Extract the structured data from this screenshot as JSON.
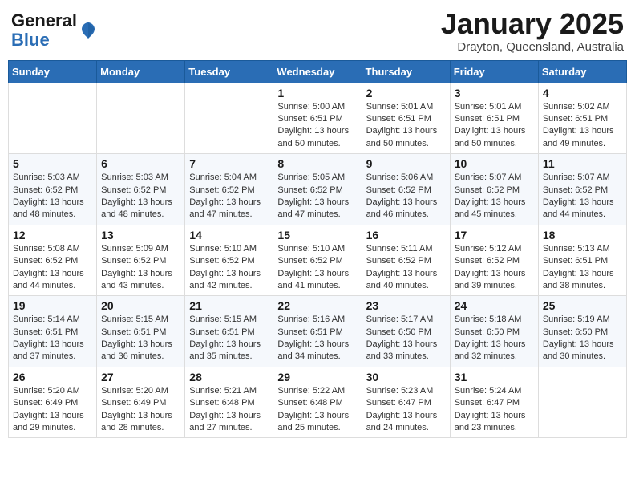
{
  "header": {
    "logo": {
      "general": "General",
      "blue": "Blue"
    },
    "title": "January 2025",
    "location": "Drayton, Queensland, Australia"
  },
  "weekdays": [
    "Sunday",
    "Monday",
    "Tuesday",
    "Wednesday",
    "Thursday",
    "Friday",
    "Saturday"
  ],
  "weeks": [
    [
      {
        "day": "",
        "info": ""
      },
      {
        "day": "",
        "info": ""
      },
      {
        "day": "",
        "info": ""
      },
      {
        "day": "1",
        "info": "Sunrise: 5:00 AM\nSunset: 6:51 PM\nDaylight: 13 hours\nand 50 minutes."
      },
      {
        "day": "2",
        "info": "Sunrise: 5:01 AM\nSunset: 6:51 PM\nDaylight: 13 hours\nand 50 minutes."
      },
      {
        "day": "3",
        "info": "Sunrise: 5:01 AM\nSunset: 6:51 PM\nDaylight: 13 hours\nand 50 minutes."
      },
      {
        "day": "4",
        "info": "Sunrise: 5:02 AM\nSunset: 6:51 PM\nDaylight: 13 hours\nand 49 minutes."
      }
    ],
    [
      {
        "day": "5",
        "info": "Sunrise: 5:03 AM\nSunset: 6:52 PM\nDaylight: 13 hours\nand 48 minutes."
      },
      {
        "day": "6",
        "info": "Sunrise: 5:03 AM\nSunset: 6:52 PM\nDaylight: 13 hours\nand 48 minutes."
      },
      {
        "day": "7",
        "info": "Sunrise: 5:04 AM\nSunset: 6:52 PM\nDaylight: 13 hours\nand 47 minutes."
      },
      {
        "day": "8",
        "info": "Sunrise: 5:05 AM\nSunset: 6:52 PM\nDaylight: 13 hours\nand 47 minutes."
      },
      {
        "day": "9",
        "info": "Sunrise: 5:06 AM\nSunset: 6:52 PM\nDaylight: 13 hours\nand 46 minutes."
      },
      {
        "day": "10",
        "info": "Sunrise: 5:07 AM\nSunset: 6:52 PM\nDaylight: 13 hours\nand 45 minutes."
      },
      {
        "day": "11",
        "info": "Sunrise: 5:07 AM\nSunset: 6:52 PM\nDaylight: 13 hours\nand 44 minutes."
      }
    ],
    [
      {
        "day": "12",
        "info": "Sunrise: 5:08 AM\nSunset: 6:52 PM\nDaylight: 13 hours\nand 44 minutes."
      },
      {
        "day": "13",
        "info": "Sunrise: 5:09 AM\nSunset: 6:52 PM\nDaylight: 13 hours\nand 43 minutes."
      },
      {
        "day": "14",
        "info": "Sunrise: 5:10 AM\nSunset: 6:52 PM\nDaylight: 13 hours\nand 42 minutes."
      },
      {
        "day": "15",
        "info": "Sunrise: 5:10 AM\nSunset: 6:52 PM\nDaylight: 13 hours\nand 41 minutes."
      },
      {
        "day": "16",
        "info": "Sunrise: 5:11 AM\nSunset: 6:52 PM\nDaylight: 13 hours\nand 40 minutes."
      },
      {
        "day": "17",
        "info": "Sunrise: 5:12 AM\nSunset: 6:52 PM\nDaylight: 13 hours\nand 39 minutes."
      },
      {
        "day": "18",
        "info": "Sunrise: 5:13 AM\nSunset: 6:51 PM\nDaylight: 13 hours\nand 38 minutes."
      }
    ],
    [
      {
        "day": "19",
        "info": "Sunrise: 5:14 AM\nSunset: 6:51 PM\nDaylight: 13 hours\nand 37 minutes."
      },
      {
        "day": "20",
        "info": "Sunrise: 5:15 AM\nSunset: 6:51 PM\nDaylight: 13 hours\nand 36 minutes."
      },
      {
        "day": "21",
        "info": "Sunrise: 5:15 AM\nSunset: 6:51 PM\nDaylight: 13 hours\nand 35 minutes."
      },
      {
        "day": "22",
        "info": "Sunrise: 5:16 AM\nSunset: 6:51 PM\nDaylight: 13 hours\nand 34 minutes."
      },
      {
        "day": "23",
        "info": "Sunrise: 5:17 AM\nSunset: 6:50 PM\nDaylight: 13 hours\nand 33 minutes."
      },
      {
        "day": "24",
        "info": "Sunrise: 5:18 AM\nSunset: 6:50 PM\nDaylight: 13 hours\nand 32 minutes."
      },
      {
        "day": "25",
        "info": "Sunrise: 5:19 AM\nSunset: 6:50 PM\nDaylight: 13 hours\nand 30 minutes."
      }
    ],
    [
      {
        "day": "26",
        "info": "Sunrise: 5:20 AM\nSunset: 6:49 PM\nDaylight: 13 hours\nand 29 minutes."
      },
      {
        "day": "27",
        "info": "Sunrise: 5:20 AM\nSunset: 6:49 PM\nDaylight: 13 hours\nand 28 minutes."
      },
      {
        "day": "28",
        "info": "Sunrise: 5:21 AM\nSunset: 6:48 PM\nDaylight: 13 hours\nand 27 minutes."
      },
      {
        "day": "29",
        "info": "Sunrise: 5:22 AM\nSunset: 6:48 PM\nDaylight: 13 hours\nand 25 minutes."
      },
      {
        "day": "30",
        "info": "Sunrise: 5:23 AM\nSunset: 6:47 PM\nDaylight: 13 hours\nand 24 minutes."
      },
      {
        "day": "31",
        "info": "Sunrise: 5:24 AM\nSunset: 6:47 PM\nDaylight: 13 hours\nand 23 minutes."
      },
      {
        "day": "",
        "info": ""
      }
    ]
  ]
}
